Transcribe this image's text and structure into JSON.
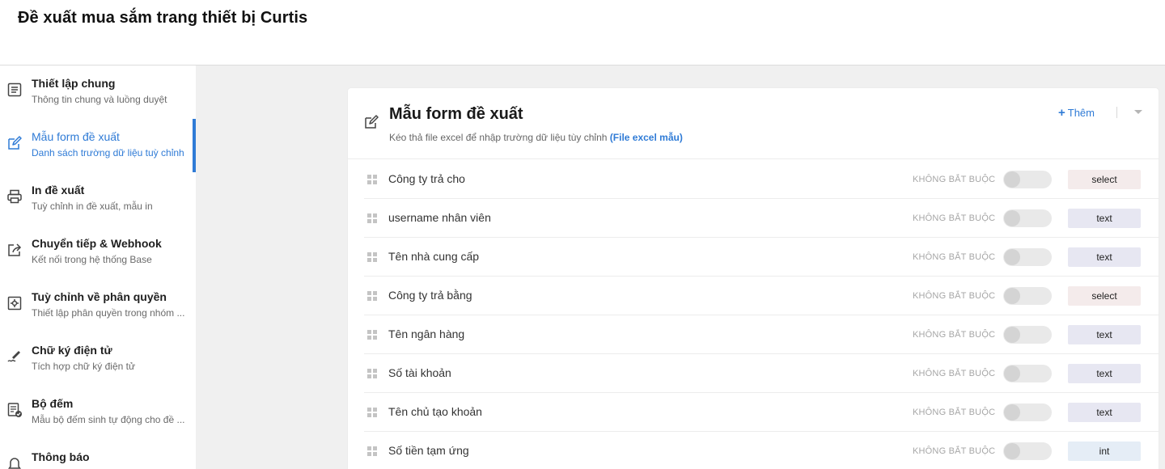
{
  "page": {
    "title": "Đề xuất mua sắm trang thiết bị Curtis"
  },
  "sidebar": {
    "items": [
      {
        "title": "Thiết lập chung",
        "sub": "Thông tin chung và luồng duyệt",
        "icon": "document-icon"
      },
      {
        "title": "Mẫu form đề xuất",
        "sub": "Danh sách trường dữ liệu tuỳ chỉnh",
        "icon": "edit-icon",
        "active": true
      },
      {
        "title": "In đề xuất",
        "sub": "Tuỳ chỉnh in đề xuất, mẫu in",
        "icon": "printer-icon"
      },
      {
        "title": "Chuyển tiếp & Webhook",
        "sub": "Kết nối trong hệ thống Base",
        "icon": "share-icon"
      },
      {
        "title": "Tuỳ chỉnh về phân quyền",
        "sub": "Thiết lập phân quyền trong nhóm ...",
        "icon": "permission-gear-icon"
      },
      {
        "title": "Chữ ký điện tử",
        "sub": "Tích hợp chữ ký điện tử",
        "icon": "signature-pen-icon"
      },
      {
        "title": "Bộ đếm",
        "sub": "Mẫu bộ đếm sinh tự động cho đề ...",
        "icon": "counter-icon"
      },
      {
        "title": "Thông báo",
        "sub": "",
        "icon": "bell-icon"
      }
    ]
  },
  "form": {
    "title": "Mẫu form đề xuất",
    "subtitle": "Kéo thả file excel để nhập trường dữ liệu tùy chỉnh",
    "sample_link": "(File excel mẫu)",
    "add_label": "Thêm",
    "fields": [
      {
        "label": "Công ty trả cho",
        "required_label": "KHÔNG BẮT BUỘC",
        "required": false,
        "type": "select"
      },
      {
        "label": "username nhân viên",
        "required_label": "KHÔNG BẮT BUỘC",
        "required": false,
        "type": "text"
      },
      {
        "label": "Tên nhà cung cấp",
        "required_label": "KHÔNG BẮT BUỘC",
        "required": false,
        "type": "text"
      },
      {
        "label": "Công ty trả bằng",
        "required_label": "KHÔNG BẮT BUỘC",
        "required": false,
        "type": "select"
      },
      {
        "label": "Tên ngân hàng",
        "required_label": "KHÔNG BẮT BUỘC",
        "required": false,
        "type": "text"
      },
      {
        "label": "Số tài khoản",
        "required_label": "KHÔNG BẮT BUỘC",
        "required": false,
        "type": "text"
      },
      {
        "label": "Tên chủ tạo khoản",
        "required_label": "KHÔNG BẮT BUỘC",
        "required": false,
        "type": "text"
      },
      {
        "label": "Số tiền tạm ứng",
        "required_label": "KHÔNG BẮT BUỘC",
        "required": false,
        "type": "int"
      }
    ]
  },
  "colors": {
    "accent": "#2f7bd6",
    "select_badge": "#f4ebeb",
    "text_badge": "#e7e7f2",
    "int_badge": "#e5edf6"
  }
}
